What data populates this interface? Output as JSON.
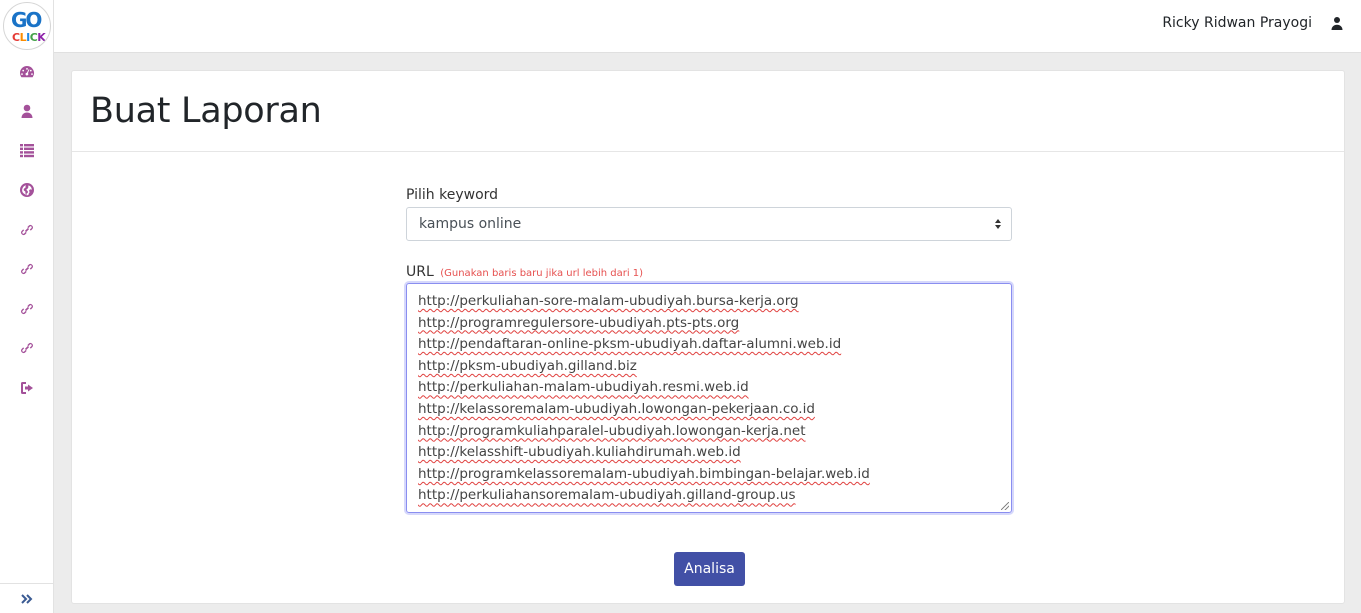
{
  "user": {
    "name": "Ricky Ridwan Prayogi",
    "icon": "user-icon"
  },
  "logo": {
    "go": "GO",
    "click": [
      "C",
      "L",
      "I",
      "C",
      "K"
    ]
  },
  "sidebar": {
    "items": [
      {
        "icon": "dashboard-icon"
      },
      {
        "icon": "user-icon"
      },
      {
        "icon": "list-icon"
      },
      {
        "icon": "globe-icon"
      },
      {
        "icon": "link-icon"
      },
      {
        "icon": "link-icon"
      },
      {
        "icon": "link-icon"
      },
      {
        "icon": "link-icon"
      },
      {
        "icon": "sign-out-icon"
      }
    ],
    "collapse_icon": "double-chevron-right-icon"
  },
  "page": {
    "title": "Buat Laporan"
  },
  "form": {
    "keyword_label": "Pilih keyword",
    "keyword_value": "kampus online",
    "url_label": "URL",
    "url_hint": "(Gunakan baris baru jika url lebih dari 1)",
    "urls": [
      "http://perkuliahan-sore-malam-ubudiyah.bursa-kerja.org",
      "http://programregulersore-ubudiyah.pts-pts.org",
      "http://pendaftaran-online-pksm-ubudiyah.daftar-alumni.web.id",
      "http://pksm-ubudiyah.gilland.biz",
      "http://perkuliahan-malam-ubudiyah.resmi.web.id",
      "http://kelassoremalam-ubudiyah.lowongan-pekerjaan.co.id",
      "http://programkuliahparalel-ubudiyah.lowongan-kerja.net",
      "http://kelasshift-ubudiyah.kuliahdirumah.web.id",
      "http://programkelassoremalam-ubudiyah.bimbingan-belajar.web.id",
      "http://perkuliahansoremalam-ubudiyah.gilland-group.us"
    ],
    "submit_label": "Analisa"
  },
  "colors": {
    "accent": "#4250a6",
    "sidebar_icon": "#a4519a",
    "hint": "#e6504f"
  }
}
